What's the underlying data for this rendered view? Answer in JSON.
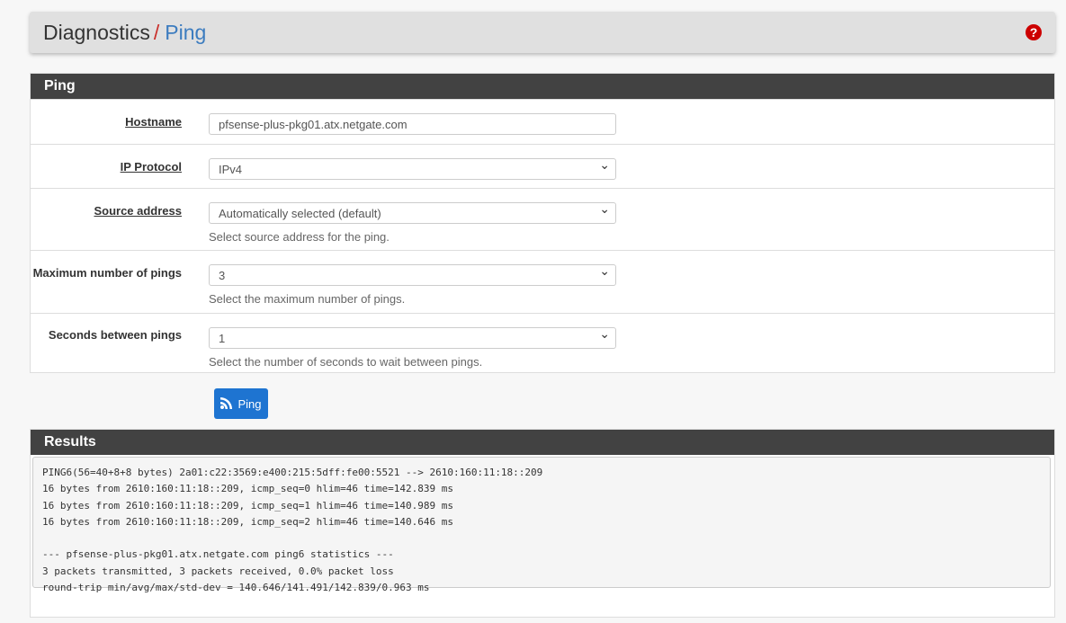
{
  "header": {
    "section": "Diagnostics",
    "separator": "/",
    "current": "Ping",
    "help_icon": "question-circle-icon"
  },
  "form": {
    "title": "Ping",
    "hostname": {
      "label": "Hostname",
      "value": "pfsense-plus-pkg01.atx.netgate.com"
    },
    "ip_protocol": {
      "label": "IP Protocol",
      "value": "IPv4"
    },
    "source": {
      "label": "Source address",
      "value": "Automatically selected (default)",
      "hint": "Select source address for the ping."
    },
    "max_pings": {
      "label": "Maximum number of pings",
      "value": "3",
      "hint": "Select the maximum number of pings."
    },
    "seconds": {
      "label": "Seconds between pings",
      "value": "1",
      "hint": "Select the number of seconds to wait between pings."
    }
  },
  "ping_button": {
    "label": "Ping",
    "icon": "rss-icon",
    "color": "#1e74d1"
  },
  "results": {
    "title": "Results",
    "lines": [
      "PING6(56=40+8+8 bytes) 2a01:c22:3569:e400:215:5dff:fe00:5521 --> 2610:160:11:18::209",
      "16 bytes from 2610:160:11:18::209, icmp_seq=0 hlim=46 time=142.839 ms",
      "16 bytes from 2610:160:11:18::209, icmp_seq=1 hlim=46 time=140.989 ms",
      "16 bytes from 2610:160:11:18::209, icmp_seq=2 hlim=46 time=140.646 ms",
      "",
      "--- pfsense-plus-pkg01.atx.netgate.com ping6 statistics ---",
      "3 packets transmitted, 3 packets received, 0.0% packet loss",
      "round-trip min/avg/max/std-dev = 140.646/141.491/142.839/0.963 ms"
    ]
  }
}
